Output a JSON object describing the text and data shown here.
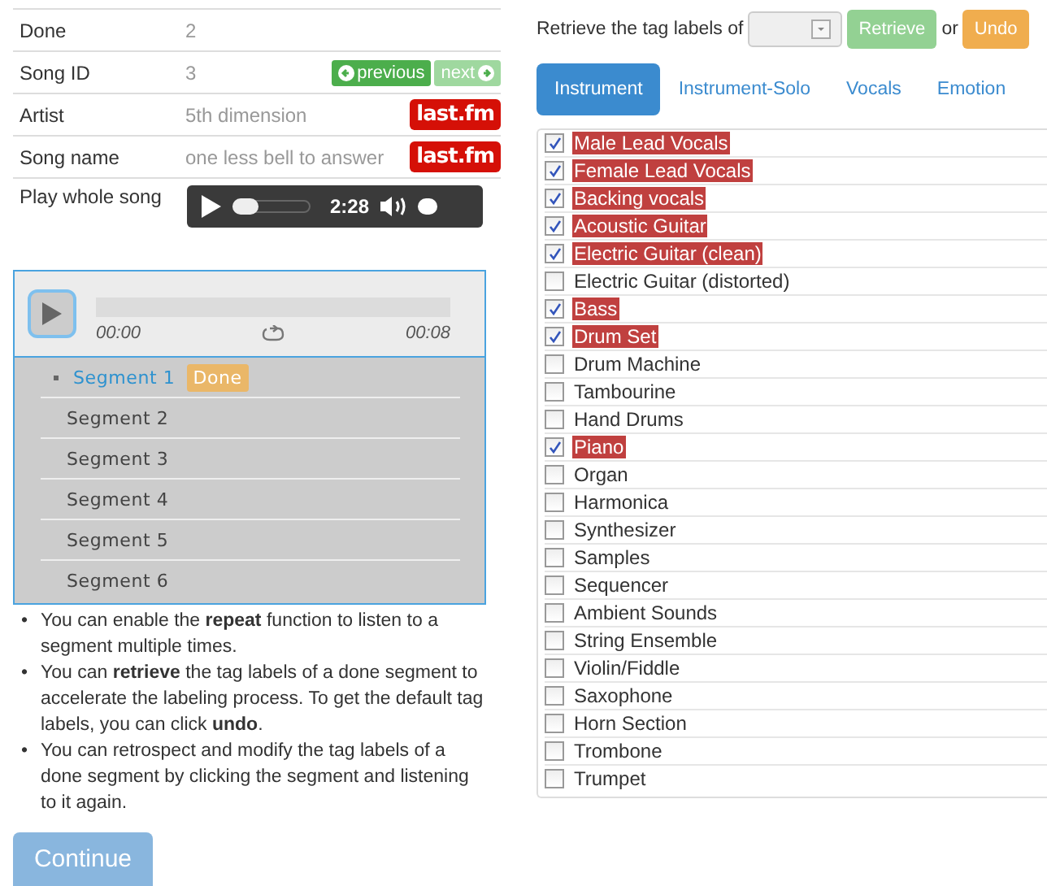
{
  "song_info": [
    {
      "label": "Done",
      "value": "2",
      "kind": "text"
    },
    {
      "label": "Song ID",
      "value": "3",
      "kind": "nav",
      "previous": {
        "label": "previous",
        "disabled": false
      },
      "next": {
        "label": "next",
        "disabled": true
      }
    },
    {
      "label": "Artist",
      "value": "5th dimension",
      "kind": "lastfm",
      "link": "last.fm"
    },
    {
      "label": "Song name",
      "value": "one less bell to answer",
      "kind": "lastfm",
      "link": "last.fm"
    },
    {
      "label": "Play whole song",
      "kind": "player",
      "time": "2:28",
      "level": 0
    }
  ],
  "segment_player": {
    "start": "00:00",
    "end": "00:08"
  },
  "segments": [
    {
      "label": "Segment 1",
      "selected": true,
      "badge": "Done"
    },
    {
      "label": "Segment 2",
      "selected": false
    },
    {
      "label": "Segment 3",
      "selected": false
    },
    {
      "label": "Segment 4",
      "selected": false
    },
    {
      "label": "Segment 5",
      "selected": false
    },
    {
      "label": "Segment 6",
      "selected": false
    }
  ],
  "notes": [
    {
      "bullet": "•",
      "text": "You can enable the **repeat** function to listen to a segment multiple times."
    },
    {
      "bullet": "•",
      "text": "You can **retrieve** the tag labels of a done segment to accelerate the labeling process. To get the default tag labels, you can click **undo**."
    },
    {
      "bullet": "•",
      "text": "You can retrospect and modify the tag labels of a done segment by clicking the segment and listening to it again."
    }
  ],
  "continue_button": "Continue",
  "retrieve": {
    "label": "Retrieve the tag labels of",
    "button": {
      "label": "Retrieve",
      "disabled": true
    },
    "or": "or",
    "undo": "Undo"
  },
  "tabs": [
    {
      "label": "Instrument",
      "selected": true
    },
    {
      "label": "Instrument-Solo",
      "selected": false
    },
    {
      "label": "Vocals",
      "selected": false
    },
    {
      "label": "Emotion",
      "selected": false
    }
  ],
  "tags": [
    {
      "label": "Male Lead Vocals",
      "checked": true
    },
    {
      "label": "Female Lead Vocals",
      "checked": true
    },
    {
      "label": "Backing vocals",
      "checked": true
    },
    {
      "label": "Acoustic Guitar",
      "checked": true
    },
    {
      "label": "Electric Guitar (clean)",
      "checked": true
    },
    {
      "label": "Electric Guitar (distorted)",
      "checked": false
    },
    {
      "label": "Bass",
      "checked": true
    },
    {
      "label": "Drum Set",
      "checked": true
    },
    {
      "label": "Drum Machine",
      "checked": false
    },
    {
      "label": "Tambourine",
      "checked": false
    },
    {
      "label": "Hand Drums",
      "checked": false
    },
    {
      "label": "Piano",
      "checked": true
    },
    {
      "label": "Organ",
      "checked": false
    },
    {
      "label": "Harmonica",
      "checked": false
    },
    {
      "label": "Synthesizer",
      "checked": false
    },
    {
      "label": "Samples",
      "checked": false
    },
    {
      "label": "Sequencer",
      "checked": false
    },
    {
      "label": "Ambient Sounds",
      "checked": false
    },
    {
      "label": "String Ensemble",
      "checked": false
    },
    {
      "label": "Violin/Fiddle",
      "checked": false
    },
    {
      "label": "Saxophone",
      "checked": false
    },
    {
      "label": "Horn Section",
      "checked": false
    },
    {
      "label": "Trombone",
      "checked": false
    },
    {
      "label": "Trumpet",
      "checked": false
    }
  ]
}
